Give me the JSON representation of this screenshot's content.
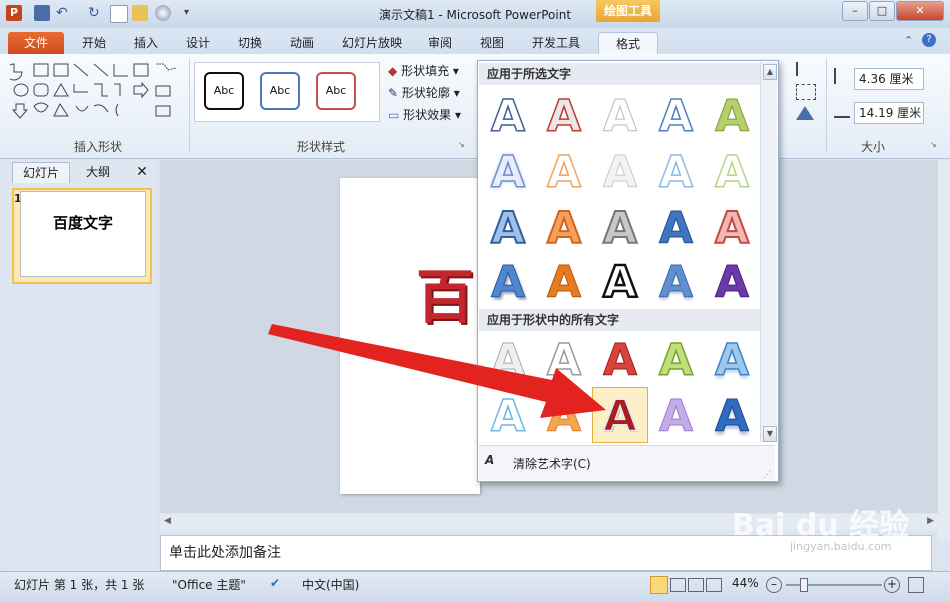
{
  "titlebar": {
    "title": "演示文稿1 - Microsoft PowerPoint",
    "context_tab_header": "绘图工具"
  },
  "tabs": [
    {
      "label": "文件"
    },
    {
      "label": "开始"
    },
    {
      "label": "插入"
    },
    {
      "label": "设计"
    },
    {
      "label": "切换"
    },
    {
      "label": "动画"
    },
    {
      "label": "幻灯片放映"
    },
    {
      "label": "审阅"
    },
    {
      "label": "视图"
    },
    {
      "label": "开发工具"
    },
    {
      "label": "格式"
    }
  ],
  "ribbon": {
    "insert_shapes_label": "插入形状",
    "shape_styles_label": "形状样式",
    "size_label": "大小",
    "style_swatches": [
      "Abc",
      "Abc",
      "Abc"
    ],
    "shape_fill": "形状填充",
    "shape_outline": "形状轮廓",
    "shape_effects": "形状效果",
    "height_value": "4.36 厘米",
    "width_value": "14.19 厘米"
  },
  "left_panel": {
    "tab_slides": "幻灯片",
    "tab_outline": "大纲",
    "close": "✕",
    "slide_number": "1",
    "thumbnail_text": "百度文字"
  },
  "slide": {
    "title_text_partial": "百"
  },
  "notes": {
    "placeholder": "单击此处添加备注"
  },
  "gallery": {
    "section1_title": "应用于所选文字",
    "section2_title": "应用于形状中的所有文字",
    "glyph": "A",
    "clear_label": "清除艺术字(C)"
  },
  "status": {
    "slide_info": "幻灯片 第 1 张，共 1 张",
    "theme": "\"Office 主题\"",
    "language": "中文(中国)",
    "zoom": "44%"
  },
  "watermark": {
    "text": "Bai du 经验",
    "url": "jingyan.baidu.com"
  }
}
